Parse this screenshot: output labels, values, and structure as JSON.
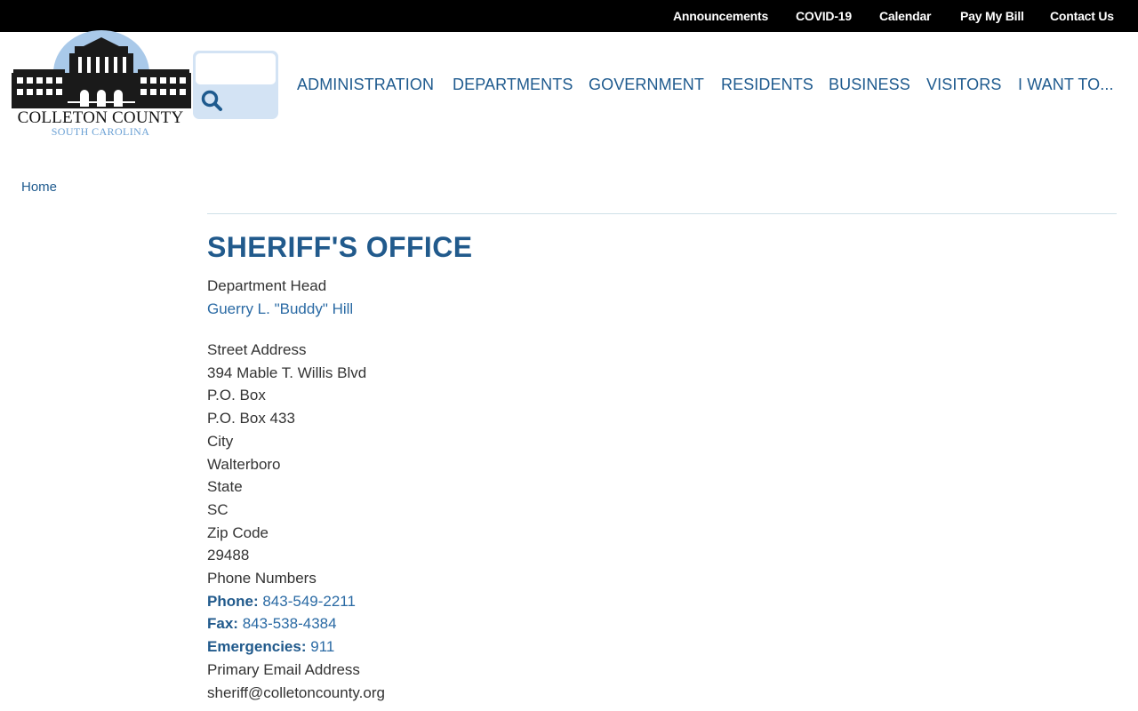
{
  "topnav": {
    "announcements": "Announcements",
    "covid": "COVID-19",
    "calendar": "Calendar",
    "pay_bill": "Pay My Bill",
    "contact": "Contact Us"
  },
  "logo": {
    "name": "COLLETON COUNTY",
    "state": "SOUTH CAROLINA"
  },
  "search": {
    "placeholder": "",
    "value": ""
  },
  "mainnav": {
    "administration": "ADMINISTRATION",
    "departments": "DEPARTMENTS",
    "government": "GOVERNMENT",
    "residents": "RESIDENTS",
    "business": "BUSINESS",
    "visitors": "VISITORS",
    "i_want_to": "I WANT TO..."
  },
  "breadcrumb": {
    "home": "Home"
  },
  "page": {
    "title": "SHERIFF'S OFFICE"
  },
  "department": {
    "head_label": "Department Head",
    "head_name": "Guerry L. \"Buddy\" Hill",
    "street_label": "Street Address",
    "street_value": "394 Mable T. Willis Blvd",
    "pobox_label": "P.O. Box",
    "pobox_value": "P.O. Box 433",
    "city_label": "City",
    "city_value": "Walterboro",
    "state_label": "State",
    "state_value": "SC",
    "zip_label": "Zip Code",
    "zip_value": "29488",
    "phones_label": "Phone Numbers",
    "phone_label": "Phone:",
    "phone_value": "843-549-2211",
    "fax_label": "Fax:",
    "fax_value": "843-538-4384",
    "emergency_label": "Emergencies:",
    "emergency_value": "911",
    "email_label": "Primary Email Address",
    "email_value": "sheriff@colletoncounty.org"
  },
  "colors": {
    "topbar": "#000000",
    "nav_blue": "#1e5a8e",
    "title_blue": "#215a8c",
    "link_blue": "#2a6aa4",
    "search_bg": "#d3e3f4"
  }
}
